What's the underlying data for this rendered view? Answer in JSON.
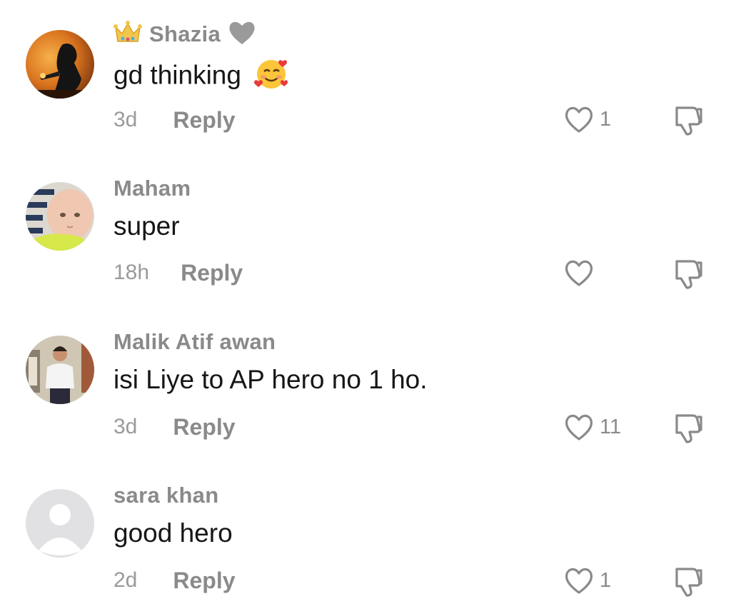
{
  "comments": [
    {
      "username": "Shazia",
      "text": "gd thinking",
      "time": "3d",
      "reply_label": "Reply",
      "likes": "1",
      "name_prefix_icon": "crown-icon",
      "name_suffix_icon": "grey-heart-icon",
      "text_emoji": "smiling-face-with-hearts"
    },
    {
      "username": "Maham",
      "text": "super",
      "time": "18h",
      "reply_label": "Reply",
      "likes": ""
    },
    {
      "username": "Malik Atif awan",
      "text": "isi Liye to AP hero no 1 ho.",
      "time": "3d",
      "reply_label": "Reply",
      "likes": "11"
    },
    {
      "username": "sara khan",
      "text": "good hero",
      "time": "2d",
      "reply_label": "Reply",
      "likes": "1"
    }
  ],
  "colors": {
    "text_primary": "#161616",
    "text_secondary": "#8a8a8a",
    "icon": "#8a8a8a"
  }
}
